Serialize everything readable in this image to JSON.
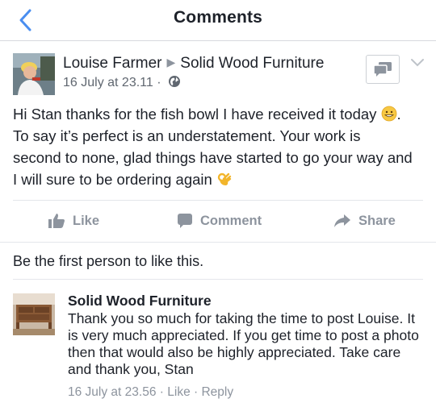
{
  "nav": {
    "title": "Comments"
  },
  "post": {
    "author": "Louise Farmer",
    "target": "Solid Wood Furniture",
    "timestamp": "16 July at 23.11",
    "separator": "·",
    "body_lines": [
      "Hi Stan thanks for the fish bowl I have received it today",
      "To say it’s perfect is an understatement. Your work is",
      "second to none, glad things have started to go your way and",
      "I will sure to be ordering again"
    ],
    "icons": {
      "back": "chevron-left-icon",
      "message": "message-icon",
      "menu": "chevron-down-icon",
      "privacy": "globe-icon",
      "emoji_1": "grinning-face-icon",
      "emoji_2": "ok-hand-icon"
    }
  },
  "actions": {
    "like": "Like",
    "comment": "Comment",
    "share": "Share"
  },
  "likes_text": "Be the first person to like this.",
  "comment": {
    "author": "Solid Wood Furniture",
    "text": "Thank you so much for taking the time to post Louise. It is very much appreciated. If you get time to post a photo then that would also be highly appreciated. Take care and thank you, Stan",
    "timestamp": "16 July at 23.56",
    "like_label": "Like",
    "reply_label": "Reply",
    "separator": "·"
  },
  "colors": {
    "accent": "#4267b2",
    "text": "#1d2129",
    "muted": "#8d949e",
    "divider": "#e4e6eb"
  }
}
